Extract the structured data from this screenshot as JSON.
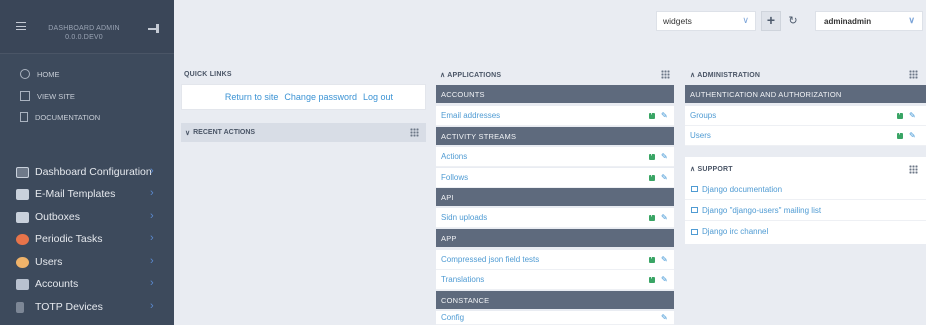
{
  "sidebar": {
    "title_line1": "DASHBOARD ADMIN",
    "title_line2": "0.0.0.DEV0",
    "links": [
      {
        "label": "HOME",
        "icon": "circle-icon"
      },
      {
        "label": "VIEW SITE",
        "icon": "external-link-icon"
      },
      {
        "label": "DOCUMENTATION",
        "icon": "document-icon"
      }
    ],
    "items": [
      {
        "label": "Dashboard Configuration",
        "icon": "dashboard-icon",
        "color": "#6f7a8a"
      },
      {
        "label": "E-Mail Templates",
        "icon": "envelope-icon",
        "color": "#c9d1dc"
      },
      {
        "label": "Outboxes",
        "icon": "outbox-icon",
        "color": "#c9d1dc"
      },
      {
        "label": "Periodic Tasks",
        "icon": "clock-icon",
        "color": "#e8744a"
      },
      {
        "label": "Users",
        "icon": "user-icon",
        "color": "#f0b36a"
      },
      {
        "label": "Accounts",
        "icon": "accounts-icon",
        "color": "#b8c1cf"
      },
      {
        "label": "TOTP Devices",
        "icon": "device-icon",
        "color": "#7d8796"
      }
    ]
  },
  "topbar": {
    "widgets_value": "widgets",
    "user_value": "adminadmin"
  },
  "quick_links": {
    "title": "QUICK LINKS",
    "links": [
      "Return to site",
      "Change password",
      "Log out"
    ]
  },
  "recent_actions": {
    "title": "RECENT ACTIONS"
  },
  "applications": {
    "title": "APPLICATIONS",
    "groups": [
      {
        "name": "ACCOUNTS",
        "models": [
          {
            "label": "Email addresses",
            "add": true
          }
        ]
      },
      {
        "name": "ACTIVITY STREAMS",
        "models": [
          {
            "label": "Actions",
            "add": true
          },
          {
            "label": "Follows",
            "add": true
          }
        ]
      },
      {
        "name": "API",
        "models": [
          {
            "label": "Sidn uploads",
            "add": true
          }
        ]
      },
      {
        "name": "APP",
        "models": [
          {
            "label": "Compressed json field tests",
            "add": true
          },
          {
            "label": "Translations",
            "add": true
          }
        ]
      },
      {
        "name": "CONSTANCE",
        "models": [
          {
            "label": "Config",
            "add": false
          }
        ]
      }
    ]
  },
  "administration": {
    "title": "ADMINISTRATION",
    "group": "AUTHENTICATION AND AUTHORIZATION",
    "models": [
      {
        "label": "Groups"
      },
      {
        "label": "Users"
      }
    ]
  },
  "support": {
    "title": "SUPPORT",
    "links": [
      "Django documentation",
      "Django \"django-users\" mailing list",
      "Django irc channel"
    ]
  }
}
